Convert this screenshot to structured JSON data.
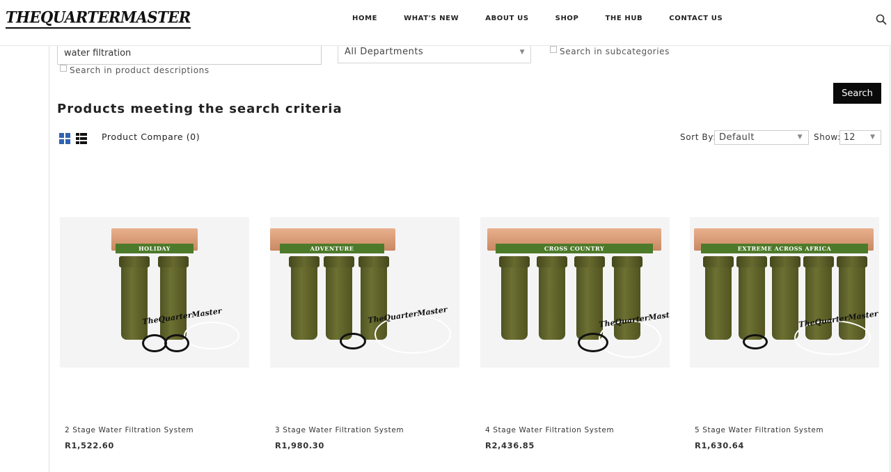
{
  "header": {
    "logo_text": "TheQuarterMaster",
    "nav": [
      "HOME",
      "WHAT'S NEW",
      "ABOUT US",
      "SHOP",
      "THE HUB",
      "CONTACT US"
    ]
  },
  "search": {
    "keyword_value": "water filtration",
    "department_value": "All Departments",
    "subcategories_label": "Search in subcategories",
    "descriptions_label": "Search in product descriptions",
    "button_label": "Search"
  },
  "results": {
    "title": "Products meeting the search criteria",
    "compare_label": "Product Compare (0)",
    "sort_label": "Sort By:",
    "sort_value": "Default",
    "show_label": "Show:",
    "show_value": "12"
  },
  "products": [
    {
      "name": "2 Stage Water Filtration System",
      "price": "R1,522.60",
      "brand_label": "HOLIDAY",
      "watermark": "TheQuarterMaster"
    },
    {
      "name": "3 Stage Water Filtration System",
      "price": "R1,980.30",
      "brand_label": "ADVENTURE",
      "watermark": "TheQuarterMaster"
    },
    {
      "name": "4 Stage Water Filtration System",
      "price": "R2,436.85",
      "brand_label": "CROSS COUNTRY",
      "watermark": "TheQuarterMaster"
    },
    {
      "name": "5 Stage Water Filtration System",
      "price": "R1,630.64",
      "brand_label": "EXTREME ACROSS AFRICA",
      "watermark": "TheQuarterMaster"
    }
  ],
  "colors": {
    "accent": "#2f63b3",
    "button_bg": "#0a0a0a",
    "canister": "#5c6028"
  },
  "icons": {
    "search": "search-icon",
    "grid_view": "grid-view-icon",
    "list_view": "list-view-icon"
  }
}
